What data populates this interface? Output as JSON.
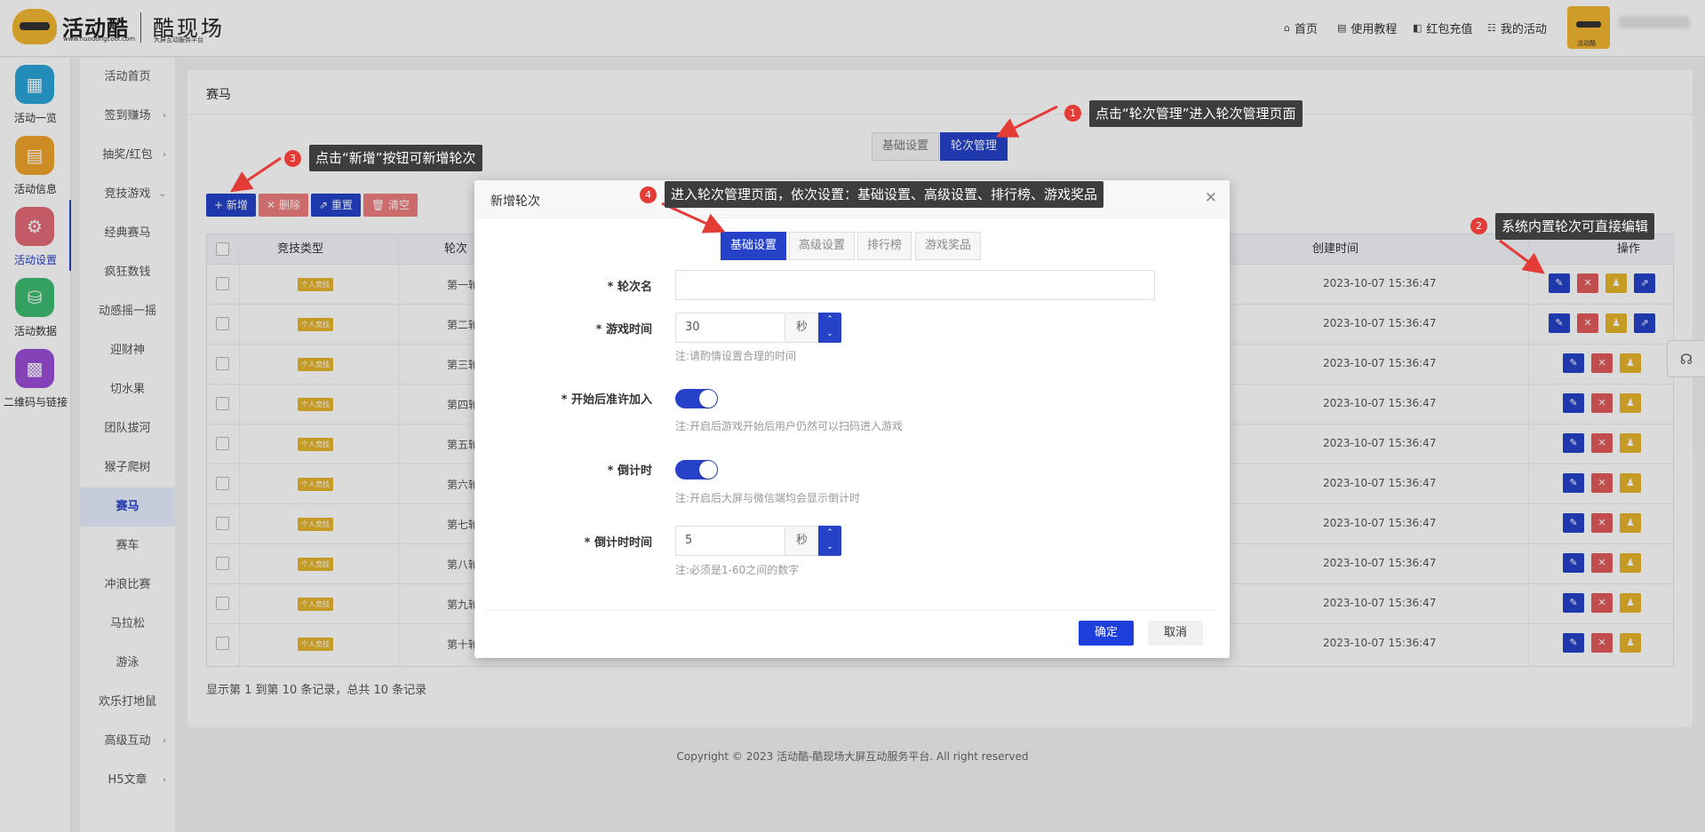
{
  "brand": {
    "name": "活动酷",
    "url": "www.huodongcool.com",
    "sub": "酷现场",
    "subtag": "大屏互动服务平台",
    "avatar_caption": "活动酷"
  },
  "topnav": [
    {
      "icon": "home-icon",
      "glyph": "⌂",
      "label": "首页"
    },
    {
      "icon": "doc-icon",
      "glyph": "▤",
      "label": "使用教程"
    },
    {
      "icon": "redpacket-icon",
      "glyph": "◧",
      "label": "红包充值"
    },
    {
      "icon": "list-icon",
      "glyph": "☷",
      "label": "我的活动"
    }
  ],
  "sidebar_main": [
    {
      "label": "活动一览",
      "color": "#2aa3d8",
      "glyph": "▦"
    },
    {
      "label": "活动信息",
      "color": "#f0a42a",
      "glyph": "▤"
    },
    {
      "label": "活动设置",
      "color": "#e46a78",
      "glyph": "⚙"
    },
    {
      "label": "活动数据",
      "color": "#3dbc72",
      "glyph": "⛁"
    },
    {
      "label": "二维码与链接",
      "color": "#9b4cd6",
      "glyph": "▩"
    }
  ],
  "sidebar_sub": [
    {
      "label": "活动首页",
      "arrow": ""
    },
    {
      "label": "签到赚场",
      "arrow": "›"
    },
    {
      "label": "抽奖/红包",
      "arrow": "›"
    },
    {
      "label": "竞技游戏",
      "arrow": "⌄"
    },
    {
      "label": "经典赛马",
      "arrow": ""
    },
    {
      "label": "疯狂数钱",
      "arrow": ""
    },
    {
      "label": "动感摇一摇",
      "arrow": ""
    },
    {
      "label": "迎财神",
      "arrow": ""
    },
    {
      "label": "切水果",
      "arrow": ""
    },
    {
      "label": "团队拔河",
      "arrow": ""
    },
    {
      "label": "猴子爬树",
      "arrow": ""
    },
    {
      "label": "赛马",
      "arrow": ""
    },
    {
      "label": "赛车",
      "arrow": ""
    },
    {
      "label": "冲浪比赛",
      "arrow": ""
    },
    {
      "label": "马拉松",
      "arrow": ""
    },
    {
      "label": "游泳",
      "arrow": ""
    },
    {
      "label": "欢乐打地鼠",
      "arrow": ""
    },
    {
      "label": "高级互动",
      "arrow": "›"
    },
    {
      "label": "H5文章",
      "arrow": "›"
    }
  ],
  "page": {
    "title": "赛马",
    "tabs": [
      "基础设置",
      "轮次管理"
    ],
    "toolbar": {
      "add": "+ 新增",
      "delete": "✕ 删除",
      "reset": "⇗ 重置",
      "clear": "🗑 清空"
    },
    "columns": [
      "竞技类型",
      "轮次",
      "创建时间",
      "操作"
    ],
    "rows": [
      {
        "type": "个人竞技",
        "name": "第一轮",
        "time": "2023-10-07 15:36:47"
      },
      {
        "type": "个人竞技",
        "name": "第二轮",
        "time": "2023-10-07 15:36:47"
      },
      {
        "type": "个人竞技",
        "name": "第三轮",
        "time": "2023-10-07 15:36:47"
      },
      {
        "type": "个人竞技",
        "name": "第四轮",
        "time": "2023-10-07 15:36:47"
      },
      {
        "type": "个人竞技",
        "name": "第五轮",
        "time": "2023-10-07 15:36:47"
      },
      {
        "type": "个人竞技",
        "name": "第六轮",
        "time": "2023-10-07 15:36:47"
      },
      {
        "type": "个人竞技",
        "name": "第七轮",
        "time": "2023-10-07 15:36:47"
      },
      {
        "type": "个人竞技",
        "name": "第八轮",
        "time": "2023-10-07 15:36:47"
      },
      {
        "type": "个人竞技",
        "name": "第九轮",
        "time": "2023-10-07 15:36:47"
      },
      {
        "type": "个人竞技",
        "name": "第十轮",
        "time": "2023-10-07 15:36:47"
      }
    ],
    "pager": "显示第 1 到第 10 条记录，总共 10 条记录"
  },
  "footer": "Copyright © 2023 活动酷-酷现场大屏互动服务平台. All right reserved",
  "modal": {
    "title": "新增轮次",
    "tabs": [
      "基础设置",
      "高级设置",
      "排行榜",
      "游戏奖品"
    ],
    "fields": {
      "round_name": {
        "label": "* 轮次名",
        "value": ""
      },
      "game_time": {
        "label": "* 游戏时间",
        "value": "30",
        "unit": "秒",
        "note": "注:请酌情设置合理的时间"
      },
      "allow_join": {
        "label": "* 开始后准许加入",
        "on": true,
        "note": "注:开启后游戏开始后用户仍然可以扫码进入游戏"
      },
      "countdown": {
        "label": "* 倒计时",
        "on": true,
        "note": "注:开启后大屏与微信端均会显示倒计时"
      },
      "countdown_time": {
        "label": "* 倒计时时间",
        "value": "5",
        "unit": "秒",
        "note": "注:必须是1-60之间的数字"
      }
    },
    "confirm": "确定",
    "cancel": "取消"
  },
  "callouts": [
    {
      "num": "1",
      "text": "点击“轮次管理”进入轮次管理页面"
    },
    {
      "num": "2",
      "text": "系统内置轮次可直接编辑"
    },
    {
      "num": "3",
      "text": "点击“新增”按钮可新增轮次"
    },
    {
      "num": "4",
      "text": "进入轮次管理页面，依次设置：基础设置、高级设置、排行榜、游戏奖品"
    }
  ],
  "colors": {
    "accent": "#2542c9",
    "danger": "#e25a5a",
    "warning": "#e6b52c",
    "callout_bg": "#3d3d3d",
    "arrow": "#e33b36"
  }
}
